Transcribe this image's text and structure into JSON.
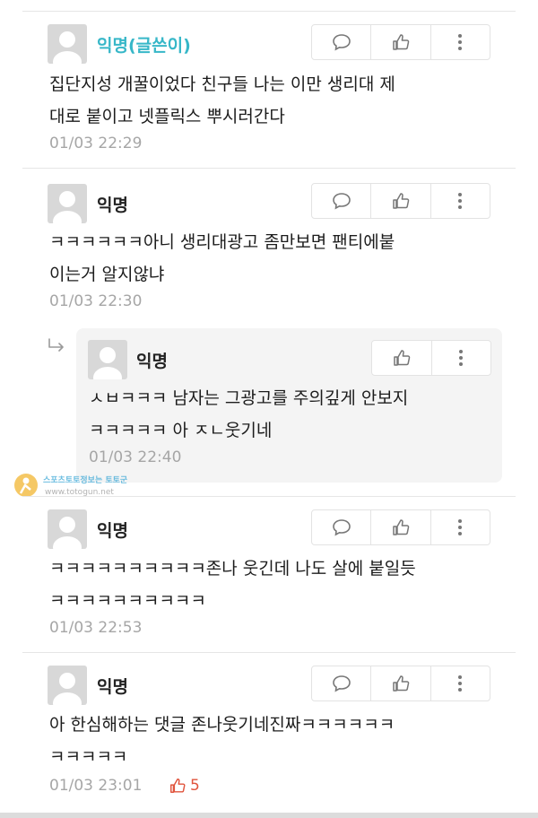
{
  "comments": [
    {
      "author": "익명(글쓴이)",
      "text": "집단지성 개꿀이었다 친구들 나는 이만 생리대 제\n대로 붙이고 넷플릭스 뿌시러간다",
      "time": "01/03 22:29"
    },
    {
      "author": "익명",
      "text": "ㅋㅋㅋㅋㅋㅋ아니 생리대광고 좀만보면 팬티에붙\n이는거 알지않냐",
      "time": "01/03 22:30"
    },
    {
      "author": "익명",
      "text": "ㅅㅂㅋㅋㅋ 남자는 그광고를 주의깊게 안보지\nㅋㅋㅋㅋㅋ 아 ㅈㄴ웃기네",
      "time": "01/03 22:40"
    },
    {
      "author": "익명",
      "text": "ㅋㅋㅋㅋㅋㅋㅋㅋㅋㅋ존나 웃긴데 나도 살에 붙일듯\nㅋㅋㅋㅋㅋㅋㅋㅋㅋㅋ",
      "time": "01/03 22:53"
    },
    {
      "author": "익명",
      "text": "아 한심해하는 댓글 존나웃기네진짜ㅋㅋㅋㅋㅋㅋ\nㅋㅋㅋㅋㅋ",
      "time": "01/03 23:01",
      "likes": "5"
    }
  ],
  "watermark": {
    "text": "스포츠토토정보는 토토군",
    "url": "www.totogun.net"
  },
  "colors": {
    "op_author": "#37b7c8",
    "like": "#e0543d",
    "time": "#a6a6a6"
  },
  "icons": [
    "comment-icon",
    "like-icon",
    "more-icon",
    "reply-arrow-icon",
    "avatar-icon"
  ]
}
